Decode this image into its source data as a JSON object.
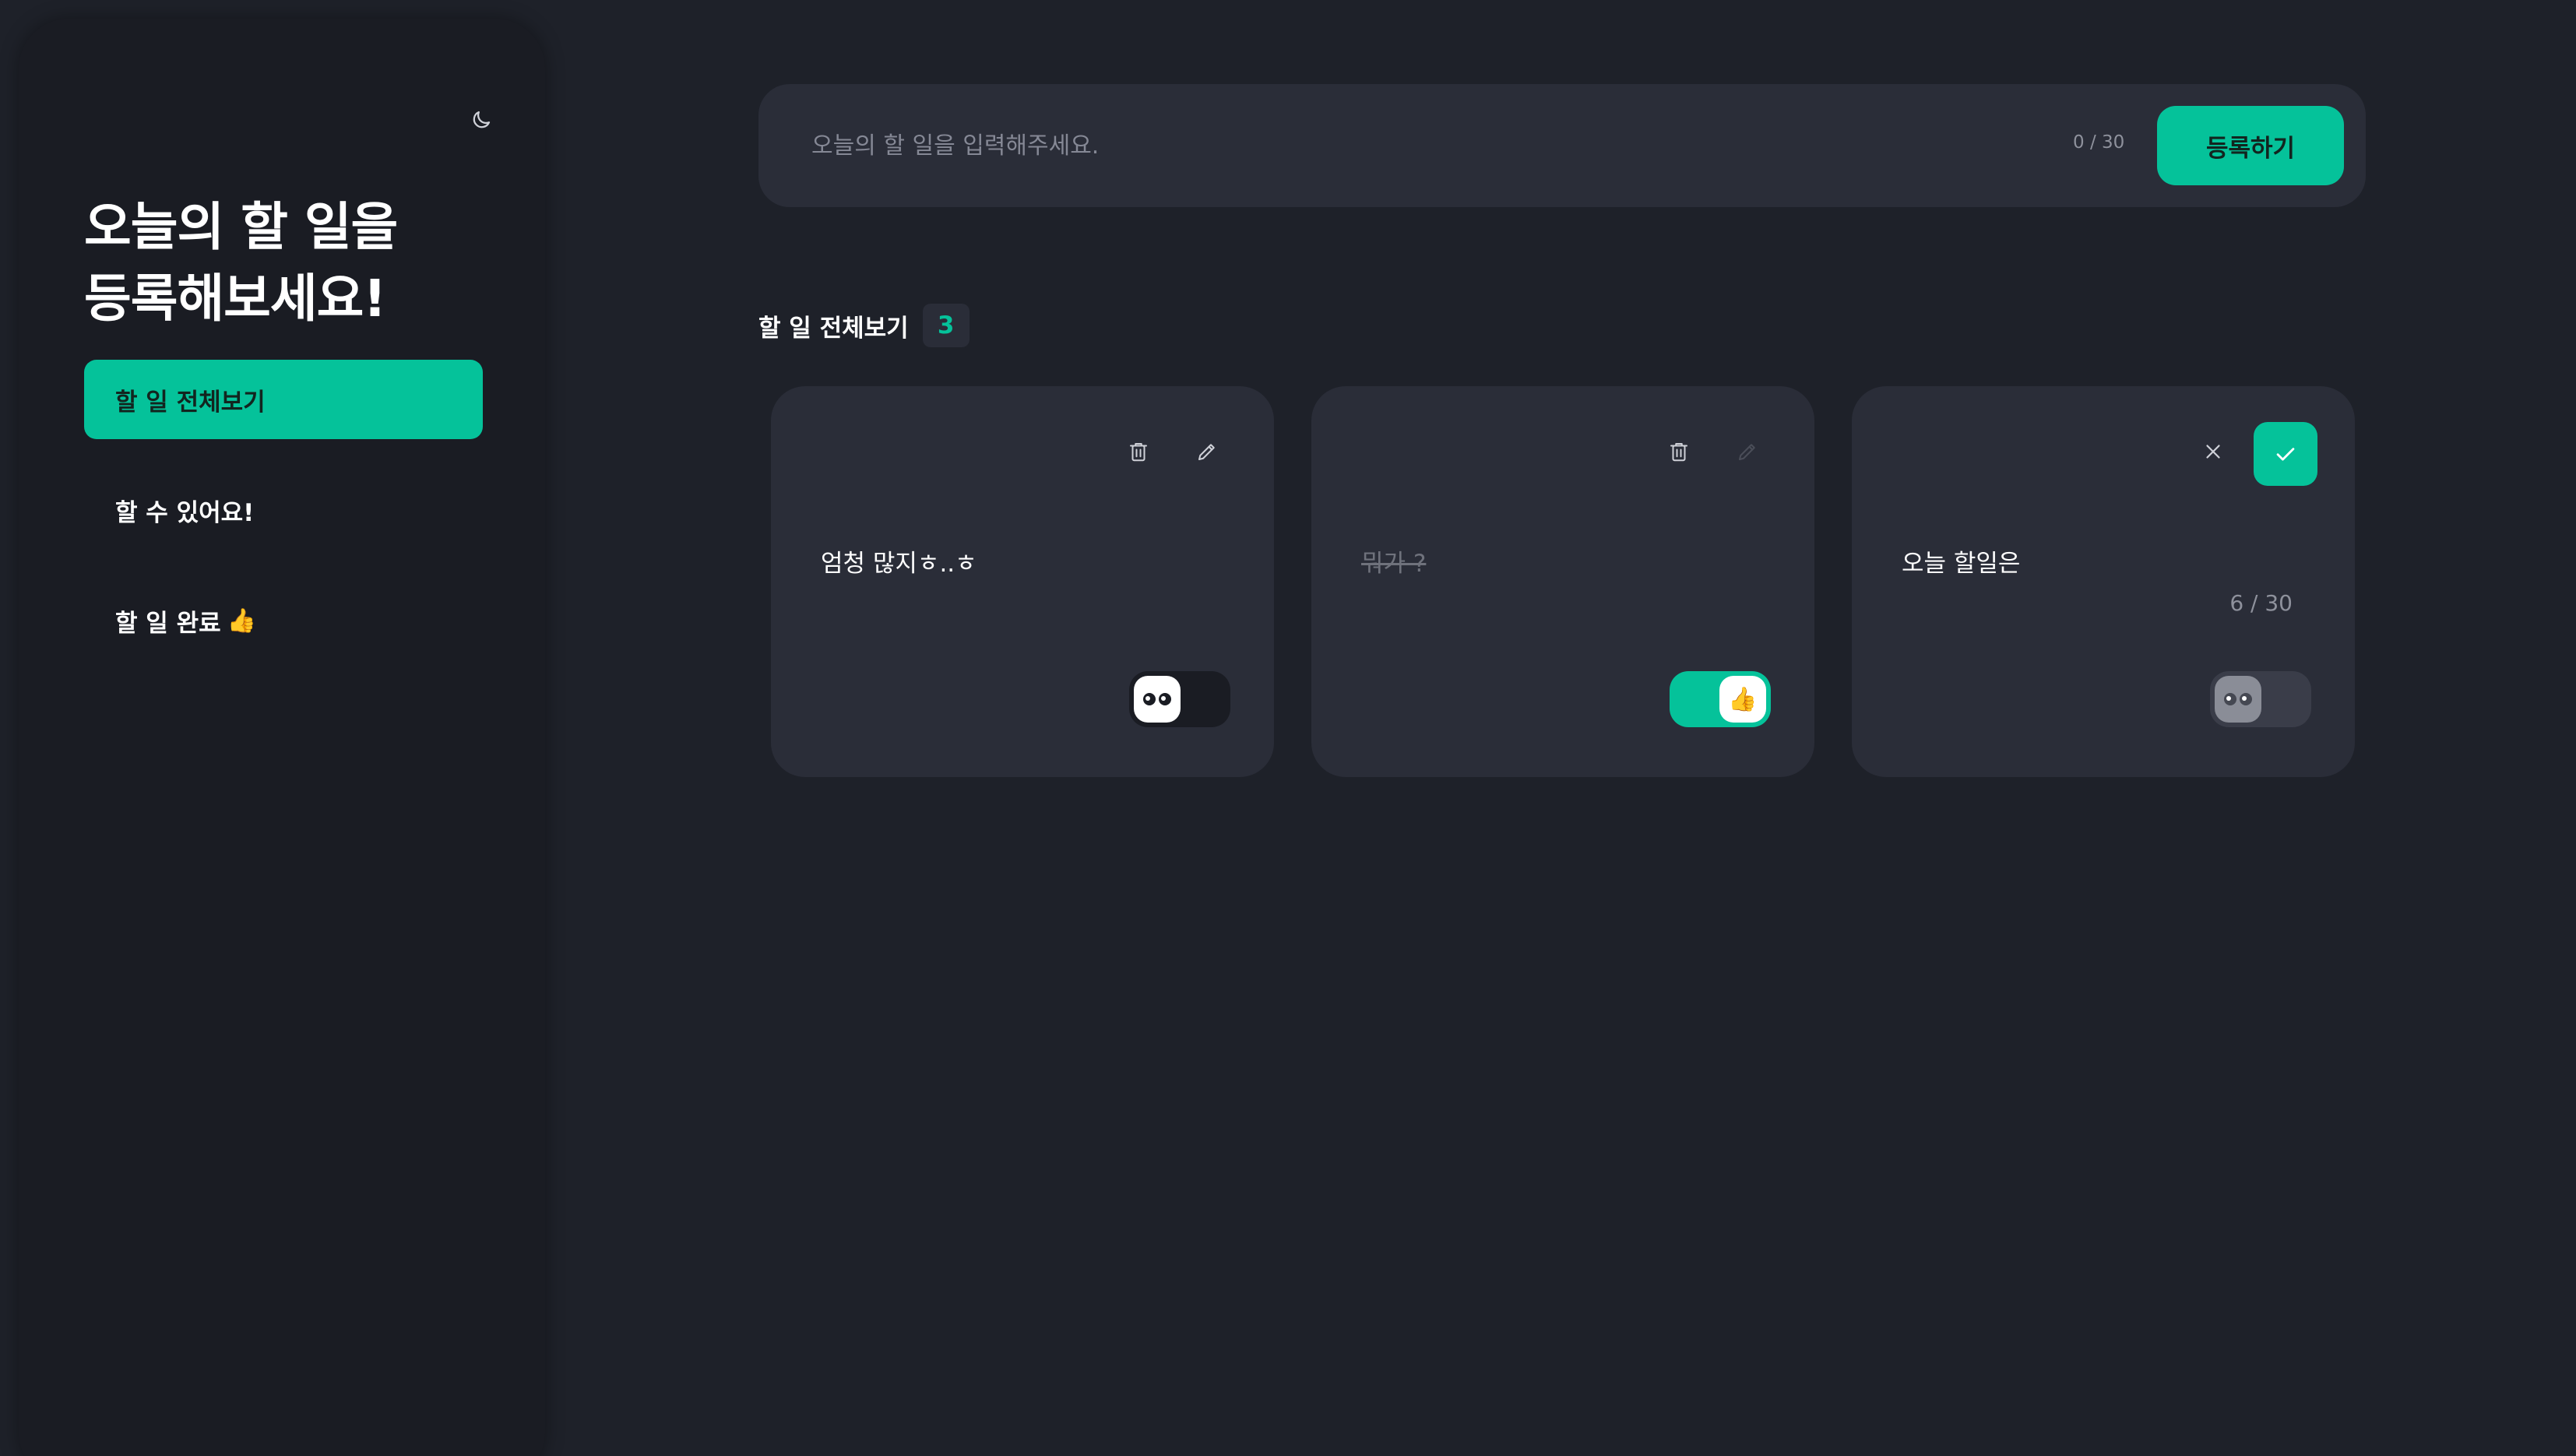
{
  "sidebar": {
    "title_line1": "오늘의 할 일을",
    "title_line2": "등록해보세요!",
    "theme_icon": "moon-icon",
    "nav": [
      {
        "label": "할 일 전체보기",
        "active": true
      },
      {
        "label": "할 수 있어요!",
        "active": false
      },
      {
        "label": "할 일 완료",
        "emoji": "👍",
        "active": false
      }
    ]
  },
  "input_bar": {
    "placeholder": "오늘의 할 일을 입력해주세요.",
    "value": "",
    "char_count": "0 / 30",
    "submit_label": "등록하기"
  },
  "section": {
    "title": "할 일 전체보기",
    "count": "3"
  },
  "todos": [
    {
      "text": "엄청 많지ㅎ..ㅎ",
      "done": false,
      "mode": "view",
      "toggle": "off"
    },
    {
      "text": "뭐가 ?",
      "done": true,
      "mode": "view",
      "toggle": "on",
      "toggle_emoji": "👍"
    },
    {
      "text": "오늘 할일은",
      "done": false,
      "mode": "edit",
      "char_count": "6 / 30",
      "toggle": "disabled"
    }
  ],
  "colors": {
    "accent": "#05c29a",
    "background": "#1e2129",
    "sidebar": "#1a1c23",
    "card": "#2a2d38"
  }
}
